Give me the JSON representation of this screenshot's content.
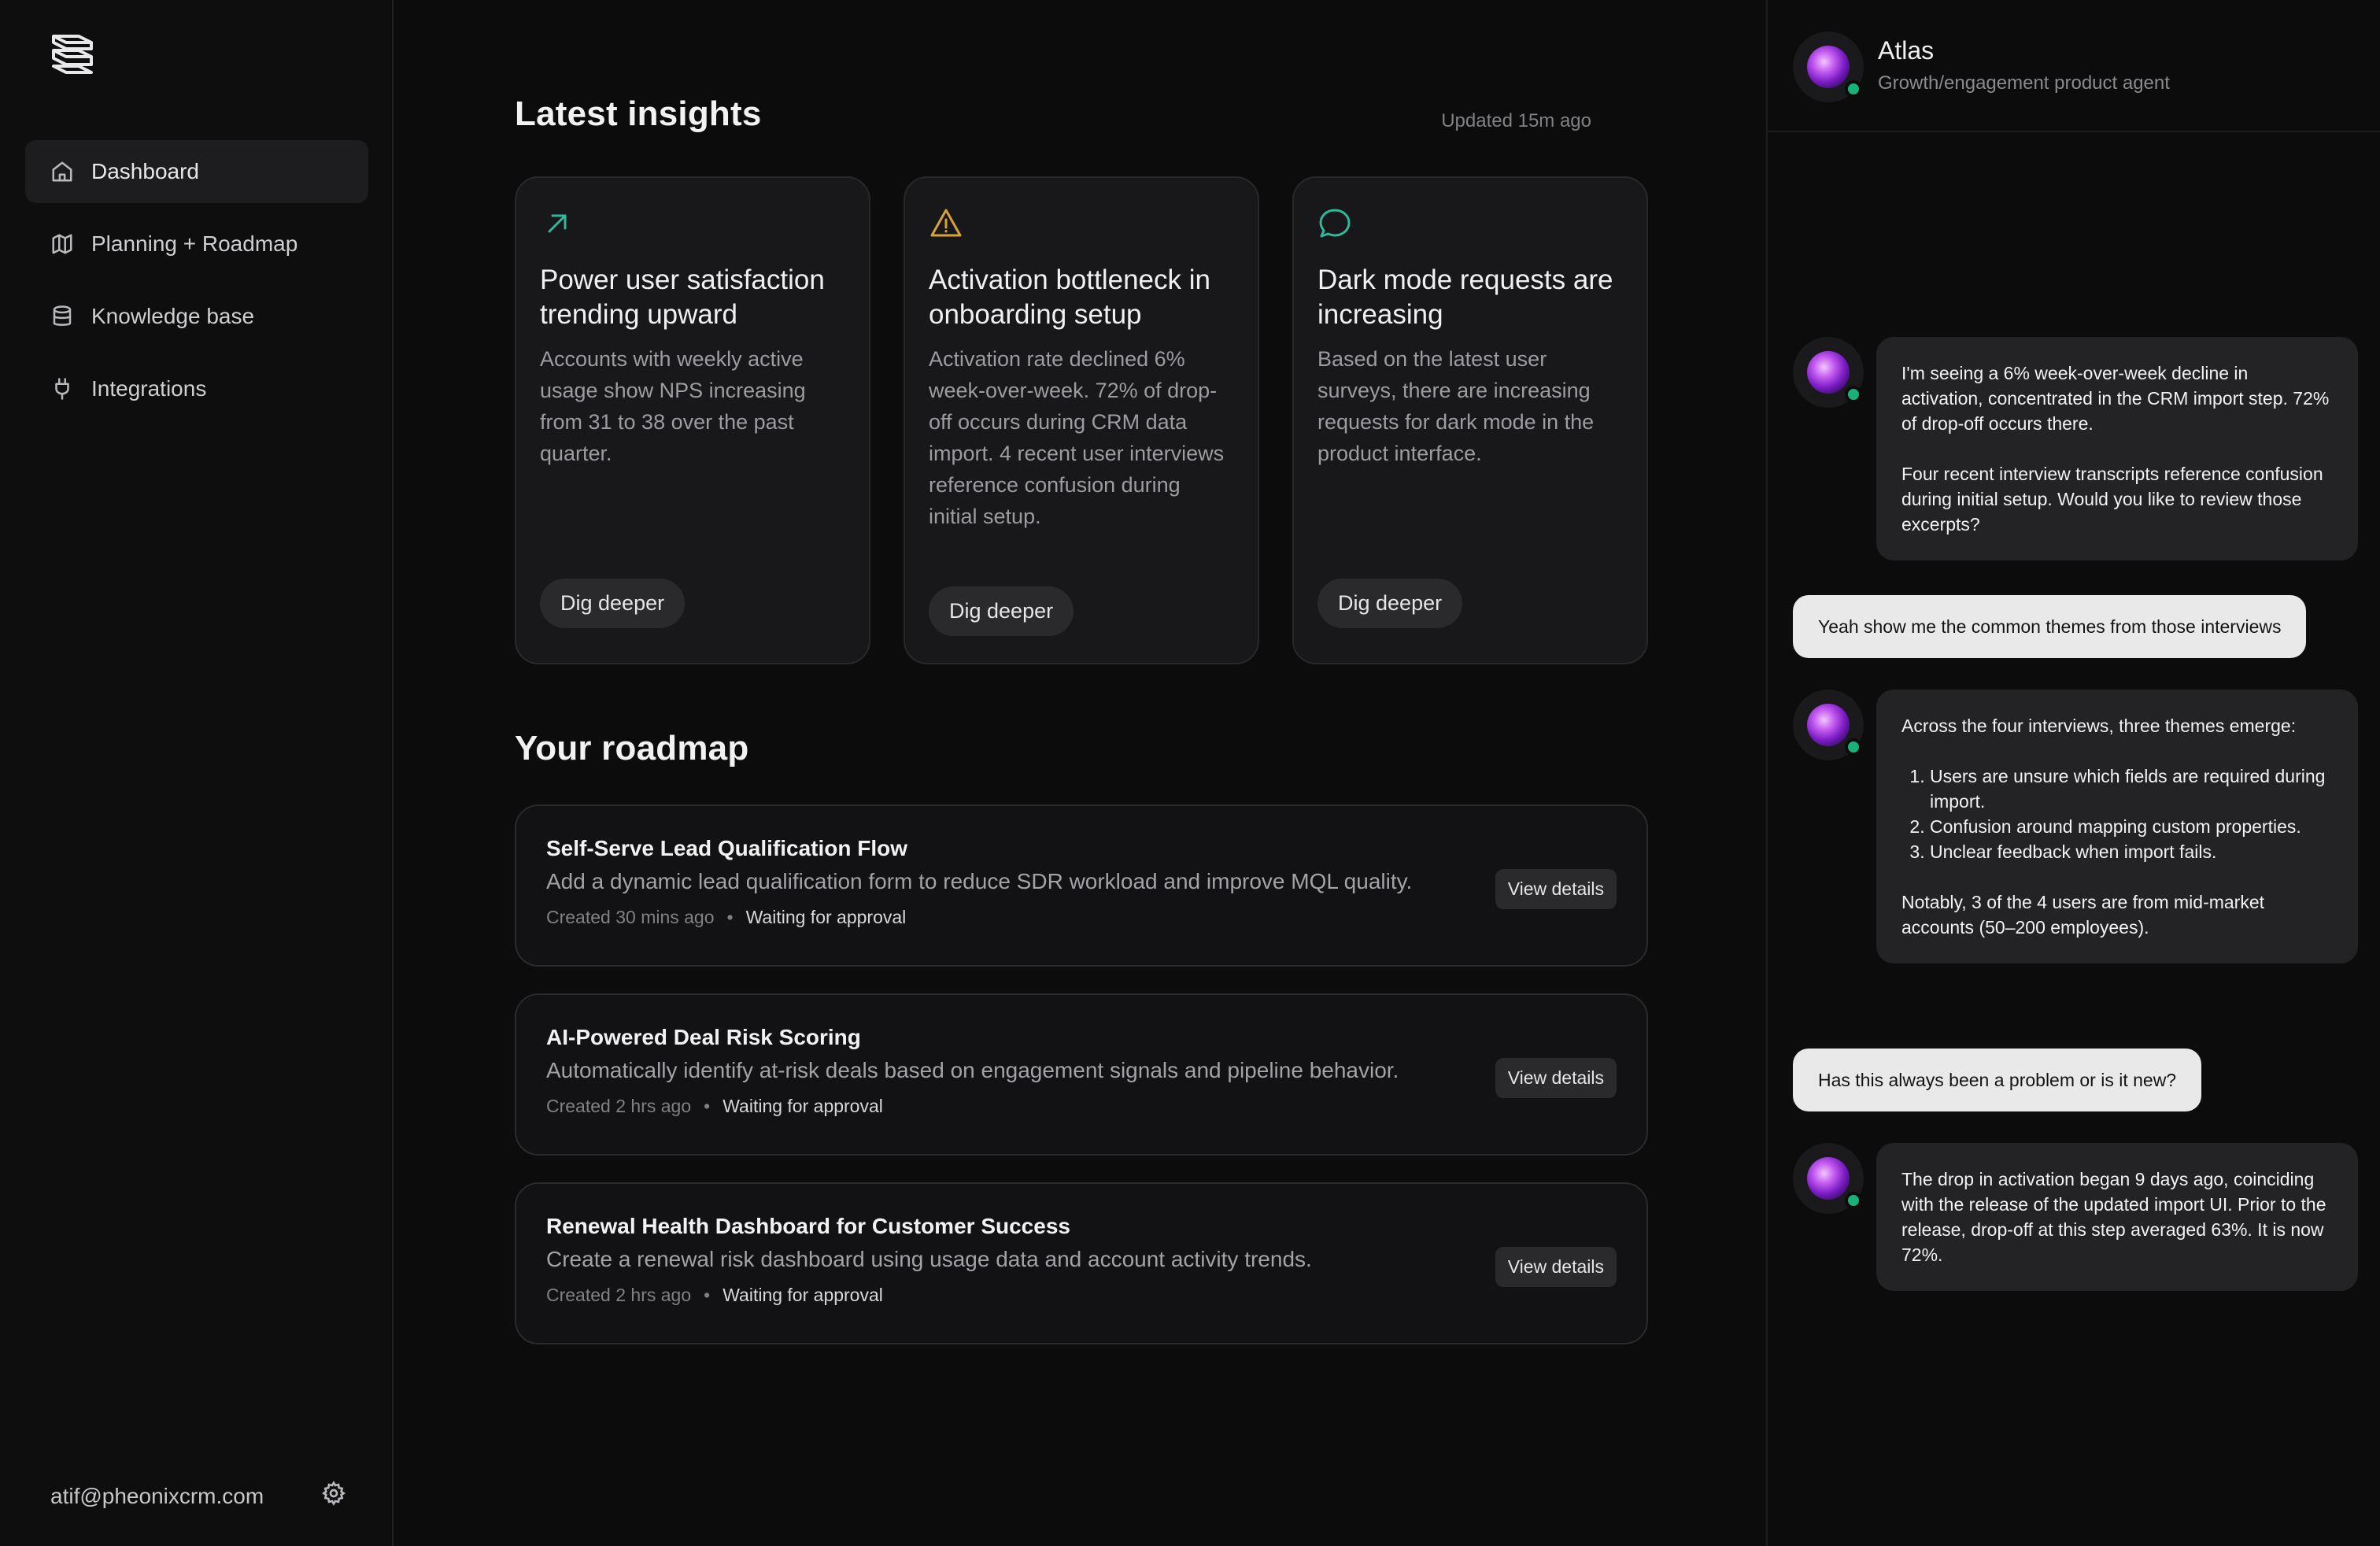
{
  "sidebar": {
    "nav": [
      {
        "label": "Dashboard",
        "icon": "home-icon",
        "active": true
      },
      {
        "label": "Planning + Roadmap",
        "icon": "map-icon"
      },
      {
        "label": "Knowledge base",
        "icon": "database-icon"
      },
      {
        "label": "Integrations",
        "icon": "plug-icon"
      }
    ],
    "user_email": "atif@pheonixcrm.com"
  },
  "insights": {
    "title": "Latest insights",
    "updated": "Updated 15m ago",
    "cards": [
      {
        "icon": "trend-up-arrow-icon",
        "icon_color": "#2fb89a",
        "title": "Power user satisfaction trending upward",
        "body": "Accounts with weekly active usage show NPS increasing from 31 to 38 over the past quarter.",
        "button": "Dig deeper"
      },
      {
        "icon": "warning-icon",
        "icon_color": "#d7a13b",
        "title": "Activation bottleneck in onboarding setup",
        "body": "Activation rate declined 6% week-over-week. 72% of drop-off occurs during CRM data import. 4 recent user interviews reference confusion during initial setup.",
        "button": "Dig deeper"
      },
      {
        "icon": "chat-bubble-icon",
        "icon_color": "#2fb89a",
        "title": "Dark mode requests are increasing",
        "body": "Based on the latest user surveys, there are increasing requests for dark mode in the product interface.",
        "button": "Dig deeper"
      }
    ]
  },
  "roadmap": {
    "title": "Your roadmap",
    "items": [
      {
        "title": "Self-Serve Lead Qualification Flow",
        "description": "Add a dynamic lead qualification form to reduce SDR workload and improve MQL quality.",
        "created": "Created 30 mins ago",
        "status": "Waiting for approval",
        "button": "View details"
      },
      {
        "title": "AI-Powered Deal Risk Scoring",
        "description": "Automatically identify at-risk deals based on engagement signals and pipeline behavior.",
        "created": "Created 2 hrs ago",
        "status": "Waiting for approval",
        "button": "View details"
      },
      {
        "title": "Renewal Health Dashboard for Customer Success",
        "description": "Create a renewal risk dashboard using usage data and account activity trends.",
        "created": "Created 2 hrs ago",
        "status": "Waiting for approval",
        "button": "View details"
      }
    ]
  },
  "chat": {
    "agent_name": "Atlas",
    "agent_role": "Growth/engagement product agent",
    "messages": [
      {
        "from": "agent",
        "p1": "I'm seeing a 6% week-over-week decline in activation, concentrated in the CRM import step. 72% of drop-off occurs there.",
        "p2": "Four recent interview transcripts reference confusion during initial setup. Would you like to review those excerpts?"
      },
      {
        "from": "user",
        "text": "Yeah show me the common themes from those interviews"
      },
      {
        "from": "agent",
        "intro": "Across the four interviews, three themes emerge:",
        "list": [
          "Users are unsure which fields are required during import.",
          "Confusion around mapping custom properties.",
          "Unclear feedback when import fails."
        ],
        "outro": "Notably, 3 of the 4 users are from mid-market accounts (50–200 employees)."
      },
      {
        "from": "user",
        "text": "Has this always been a problem or is it new?"
      },
      {
        "from": "agent",
        "p1": "The drop in activation began 9 days ago, coinciding with the release of the updated import UI. Prior to the release, drop-off at this step averaged 63%. It is now 72%."
      }
    ]
  }
}
